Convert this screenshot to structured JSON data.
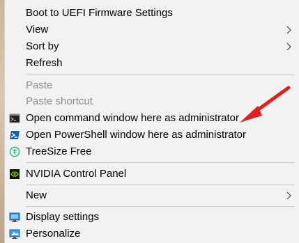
{
  "menu": {
    "boot_uefi": "Boot to UEFI Firmware Settings",
    "view": "View",
    "sort_by": "Sort by",
    "refresh": "Refresh",
    "paste": "Paste",
    "paste_shortcut": "Paste shortcut",
    "open_cmd_admin": "Open command window here as administrator",
    "open_ps_admin": "Open PowerShell window here as administrator",
    "treesize": "TreeSize Free",
    "nvidia": "NVIDIA Control Panel",
    "new": "New",
    "display_settings": "Display settings",
    "personalize": "Personalize"
  },
  "colors": {
    "menu_bg": "#f2f2f2",
    "separator": "#c8c8c8",
    "disabled_text": "#8c8c8c",
    "annotation_arrow": "#e02020"
  },
  "icons": {
    "open_cmd_admin": "command-prompt-icon",
    "open_ps_admin": "powershell-icon",
    "treesize": "treesize-icon",
    "nvidia": "nvidia-icon",
    "display_settings": "display-icon",
    "personalize": "personalize-icon",
    "submenu": "chevron-right-icon"
  }
}
